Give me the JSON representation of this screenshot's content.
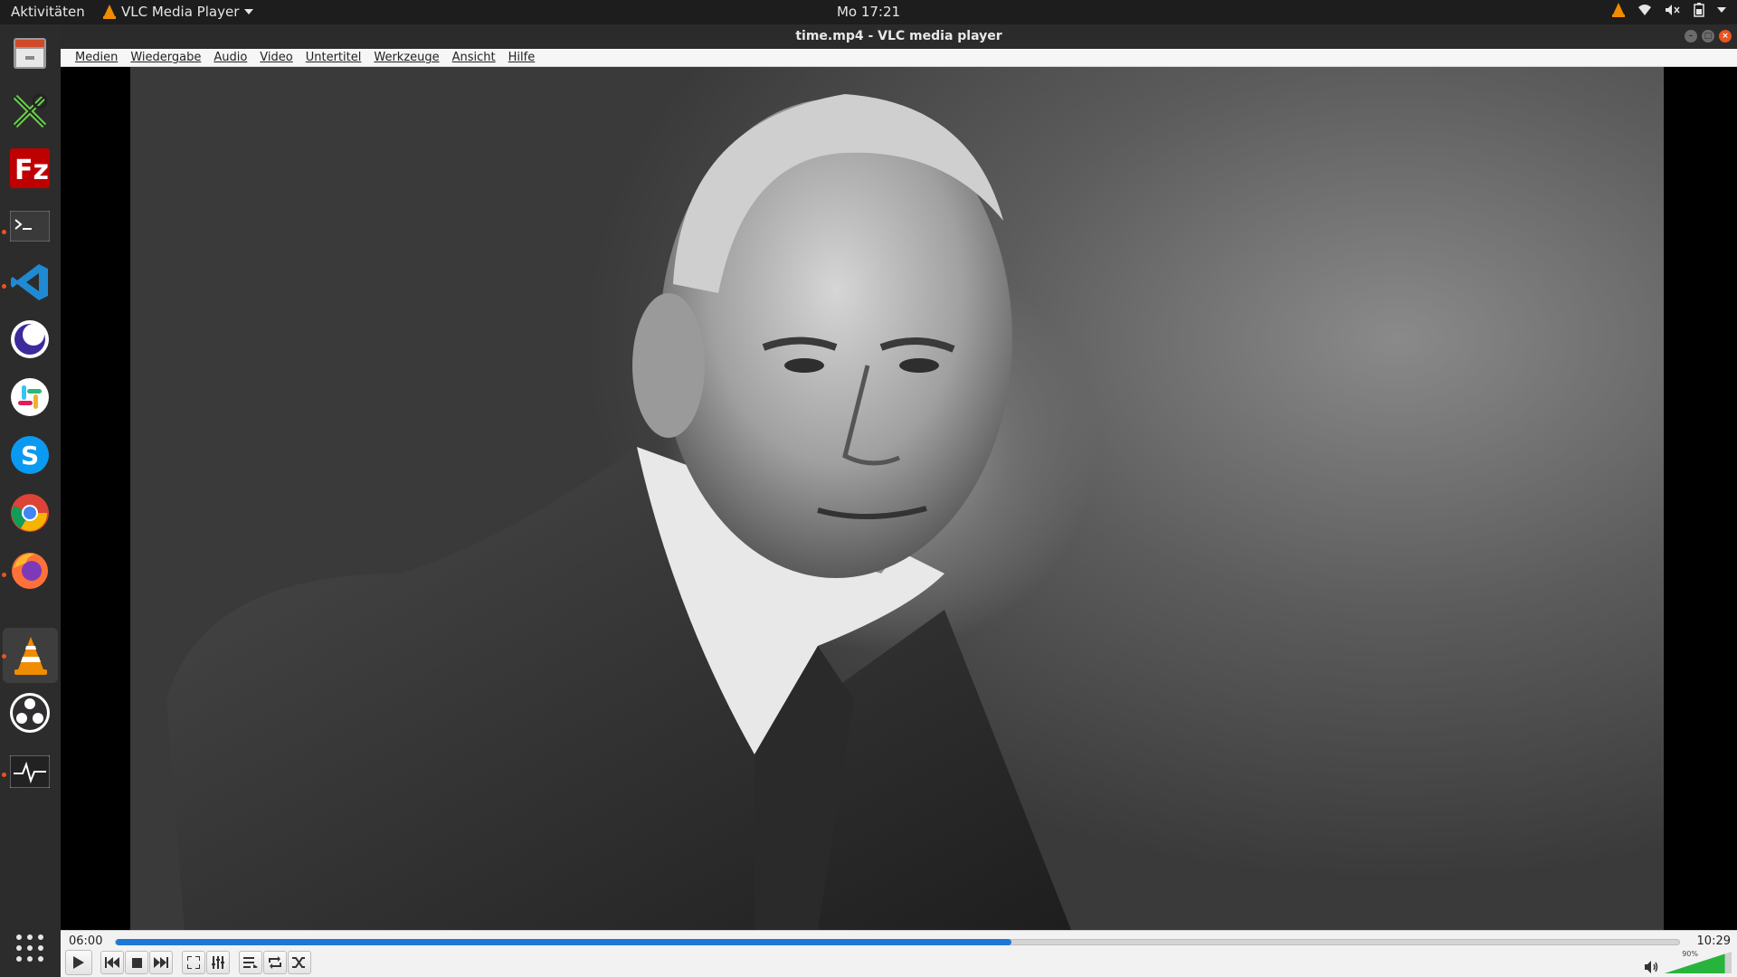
{
  "topbar": {
    "activities": "Aktivitäten",
    "app_menu": "VLC Media Player",
    "clock": "Mo 17:21"
  },
  "dock": {
    "items": [
      {
        "name": "files",
        "icon": "file-cabinet-icon"
      },
      {
        "name": "inkscape-like",
        "icon": "tools-icon"
      },
      {
        "name": "filezilla",
        "icon": "filezilla-icon"
      },
      {
        "name": "terminal",
        "icon": "terminal-icon"
      },
      {
        "name": "vscode",
        "icon": "vscode-icon"
      },
      {
        "name": "eclipse-like",
        "icon": "moon-icon"
      },
      {
        "name": "slack",
        "icon": "slack-icon"
      },
      {
        "name": "skype",
        "icon": "skype-icon"
      },
      {
        "name": "chrome",
        "icon": "chrome-icon"
      },
      {
        "name": "firefox",
        "icon": "firefox-icon"
      },
      {
        "name": "vlc",
        "icon": "vlc-cone-icon"
      },
      {
        "name": "obs",
        "icon": "obs-icon"
      },
      {
        "name": "system-monitor",
        "icon": "system-monitor-icon"
      },
      {
        "name": "show-apps",
        "icon": "app-grid-icon"
      }
    ]
  },
  "window": {
    "title": "time.mp4 - VLC media player"
  },
  "menu": {
    "items": [
      "Medien",
      "Wiedergabe",
      "Audio",
      "Video",
      "Untertitel",
      "Werkzeuge",
      "Ansicht",
      "Hilfe"
    ]
  },
  "player": {
    "current_time": "06:00",
    "total_time": "10:29",
    "progress": 0.573,
    "volume_label": "90%",
    "volume": 0.9
  },
  "colors": {
    "accent": "#1c78d4",
    "ubuntu_orange": "#e95420",
    "vlc_orange": "#f08c00"
  }
}
